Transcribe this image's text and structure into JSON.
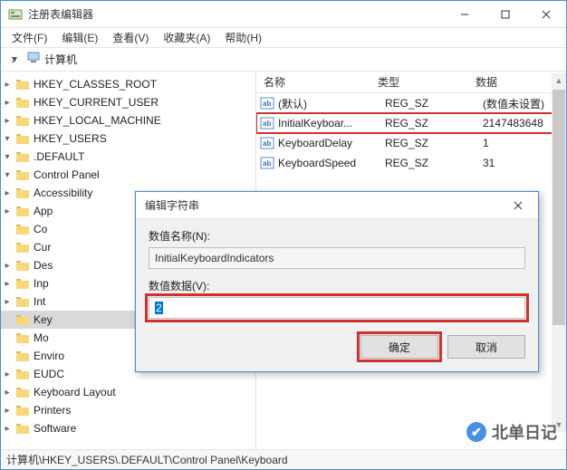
{
  "window": {
    "title": "注册表编辑器"
  },
  "menu": {
    "file": "文件(F)",
    "edit": "编辑(E)",
    "view": "查看(V)",
    "favorites": "收藏夹(A)",
    "help": "帮助(H)"
  },
  "tree": {
    "root": "计算机",
    "hkcr": "HKEY_CLASSES_ROOT",
    "hkcu": "HKEY_CURRENT_USER",
    "hklm": "HKEY_LOCAL_MACHINE",
    "hku": "HKEY_USERS",
    "default": ".DEFAULT",
    "controlpanel": "Control Panel",
    "accessibility": "Accessibility",
    "appearance": "App",
    "colors": "Co",
    "cursor": "Cur",
    "desktop": "Des",
    "input": "Inp",
    "international": "Int",
    "keyboard": "Key",
    "mouse": "Mo",
    "environment": "Enviro",
    "eudc": "EUDC",
    "keyboardlayout": "Keyboard Layout",
    "printers": "Printers",
    "software": "Software"
  },
  "list": {
    "columns": {
      "name": "名称",
      "type": "类型",
      "data": "数据"
    },
    "rows": [
      {
        "name": "(默认)",
        "type": "REG_SZ",
        "data": "(数值未设置)"
      },
      {
        "name": "InitialKeyboar...",
        "type": "REG_SZ",
        "data": "2147483648"
      },
      {
        "name": "KeyboardDelay",
        "type": "REG_SZ",
        "data": "1"
      },
      {
        "name": "KeyboardSpeed",
        "type": "REG_SZ",
        "data": "31"
      }
    ]
  },
  "dialog": {
    "title": "编辑字符串",
    "name_label": "数值名称(N):",
    "name_value": "InitialKeyboardIndicators",
    "data_label": "数值数据(V):",
    "data_value": "2",
    "ok": "确定",
    "cancel": "取消"
  },
  "statusbar": {
    "path": "计算机\\HKEY_USERS\\.DEFAULT\\Control Panel\\Keyboard"
  },
  "watermark": {
    "text": "北单日记"
  }
}
